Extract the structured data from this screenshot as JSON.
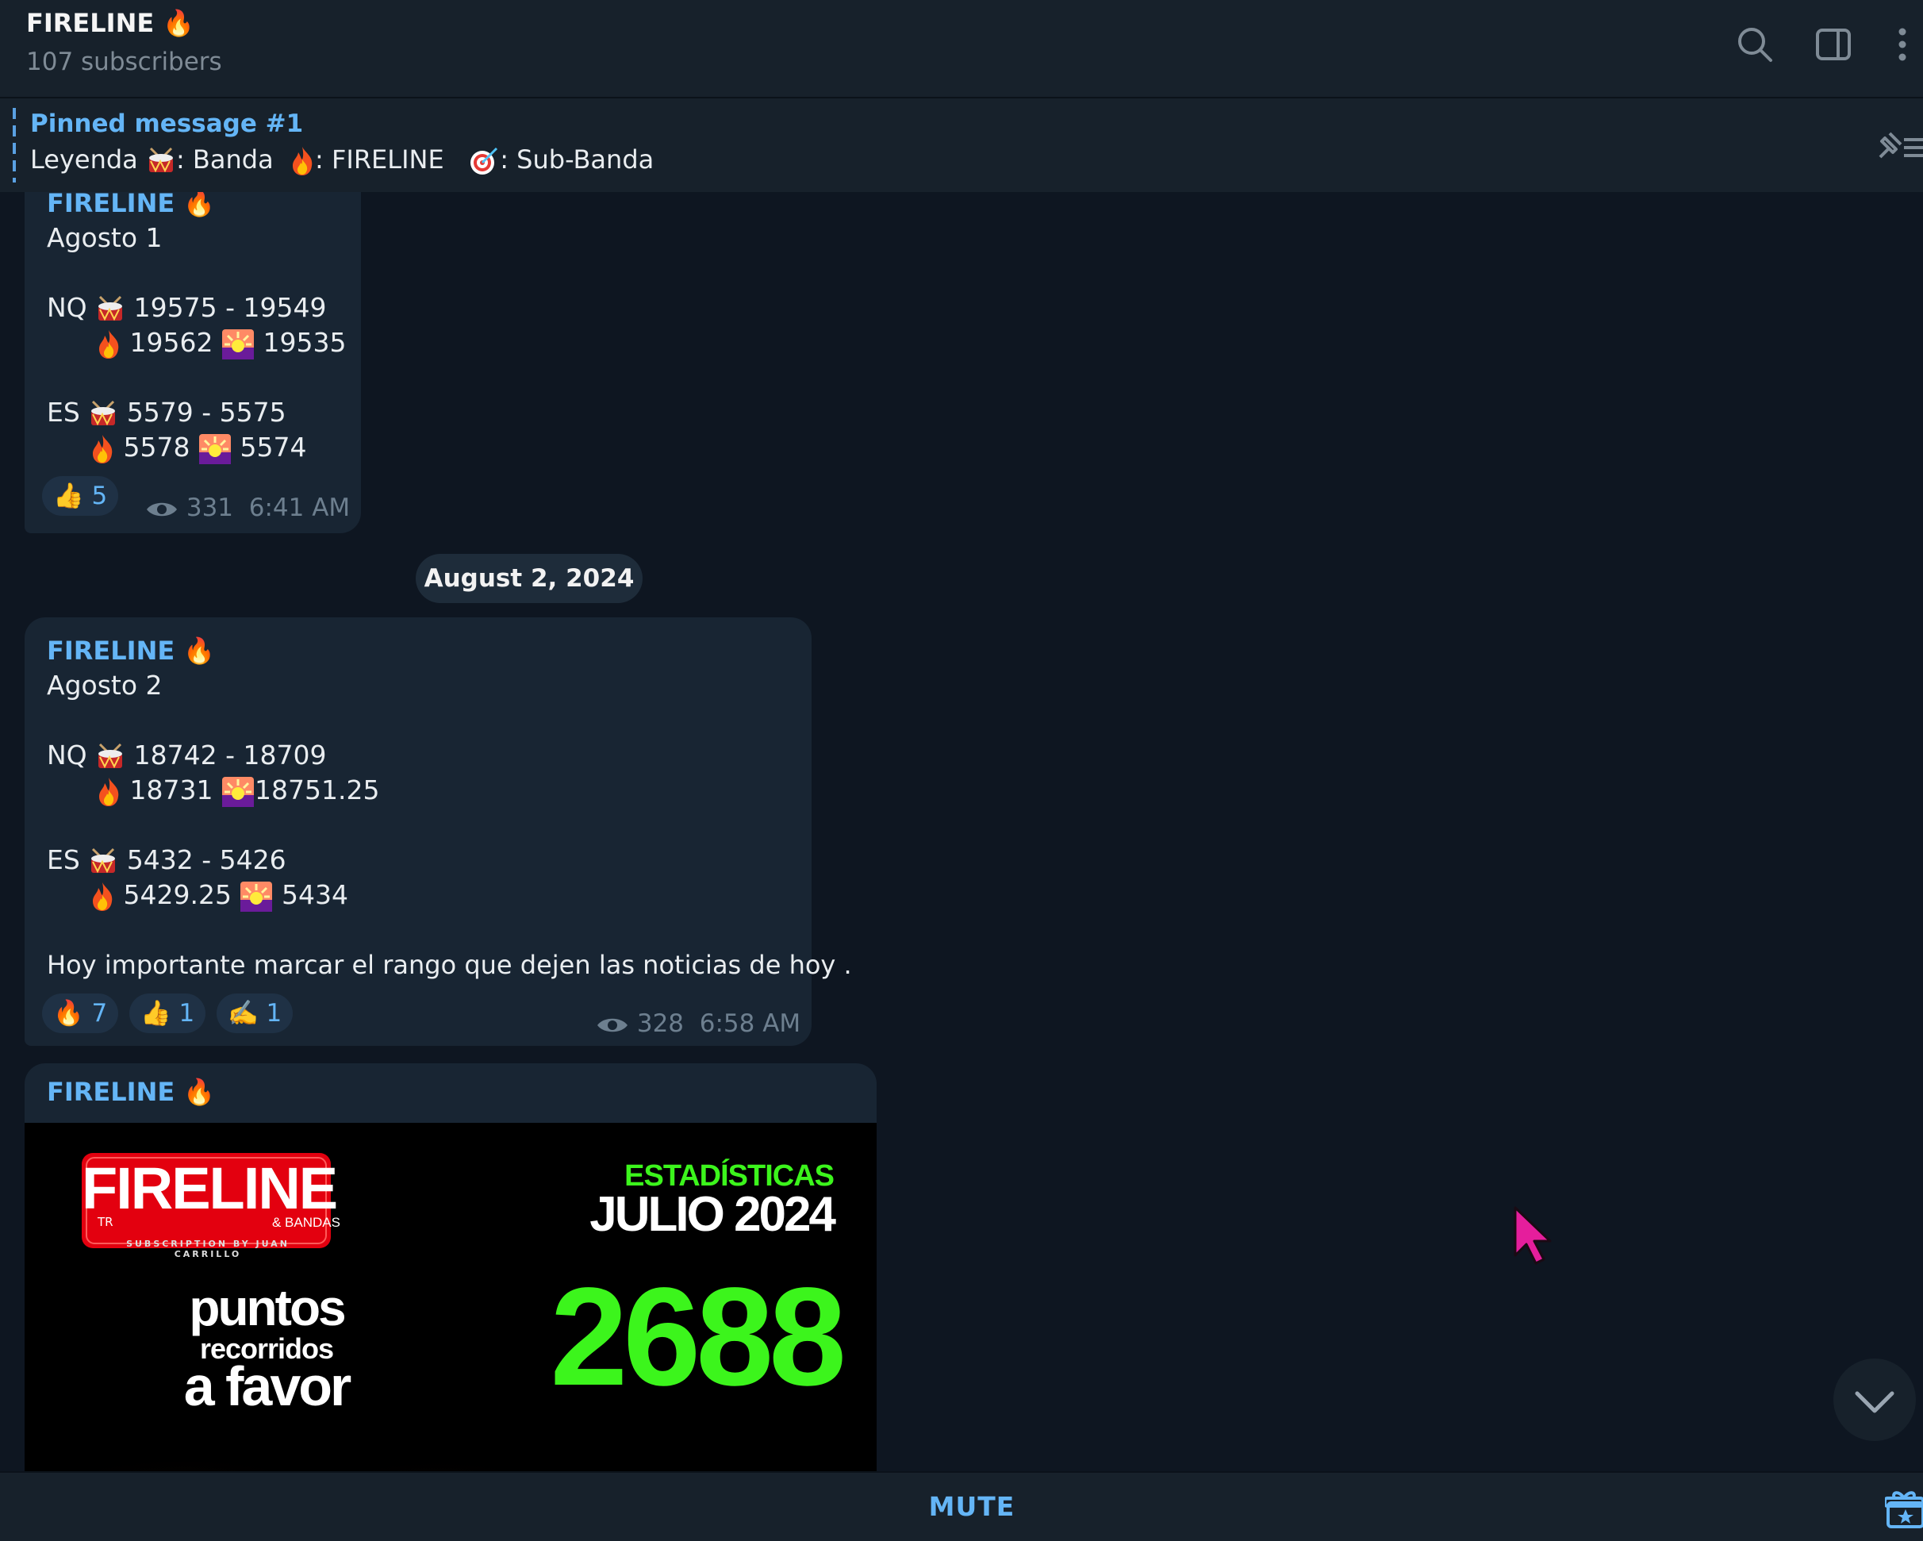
{
  "header": {
    "title": "FIRELINE 🔥",
    "subscribers": "107 subscribers"
  },
  "pinned": {
    "title": "Pinned message #1",
    "legend_prefix": "Leyenda",
    "band_label": ": Banda",
    "fireline_label": ": FIRELINE",
    "subband_label": ": Sub-Banda"
  },
  "messages": [
    {
      "sender": "FIRELINE 🔥",
      "date_line": "Agosto 1",
      "nq_label": "NQ",
      "nq_range": "19575 - 19549",
      "nq_fire": "19562",
      "nq_burst": "19535",
      "es_label": "ES",
      "es_range": "5579 - 5575",
      "es_fire": "5578",
      "es_burst": "5574",
      "reactions": [
        {
          "emoji": "👍",
          "count": "5"
        }
      ],
      "views": "331",
      "time": "6:41 AM"
    },
    {
      "sender": "FIRELINE 🔥",
      "date_line": "Agosto 2",
      "nq_label": "NQ",
      "nq_range": "18742 - 18709",
      "nq_fire": "18731",
      "nq_burst": "18751.25",
      "es_label": "ES",
      "es_range": "5432 - 5426",
      "es_fire": "5429.25",
      "es_burst": "5434",
      "note": "Hoy importante marcar el rango que dejen las noticias de hoy .",
      "reactions": [
        {
          "emoji": "🔥",
          "count": "7"
        },
        {
          "emoji": "👍",
          "count": "1"
        },
        {
          "emoji": "✍️",
          "count": "1"
        }
      ],
      "views": "328",
      "time": "6:58 AM"
    },
    {
      "sender": "FIRELINE 🔥"
    }
  ],
  "date_separator": "August 2, 2024",
  "promo_image": {
    "logo_main": "FIRELINE",
    "logo_tr": "TR",
    "logo_bandas": "& BANDAS",
    "logo_sub": "SUBSCRIPTION BY JUAN CARRILLO",
    "stats_label": "ESTADÍSTICAS",
    "month": "JULIO 2024",
    "line1": "puntos",
    "line2": "recorridos",
    "line3": "a favor",
    "number": "2688"
  },
  "bottom": {
    "mute_label": "MUTE"
  },
  "colors": {
    "accent": "#64b5f6",
    "bg": "#0e1621",
    "bubble": "#182533",
    "promo_green": "#3cf51c",
    "logo_red": "#e3000f"
  }
}
